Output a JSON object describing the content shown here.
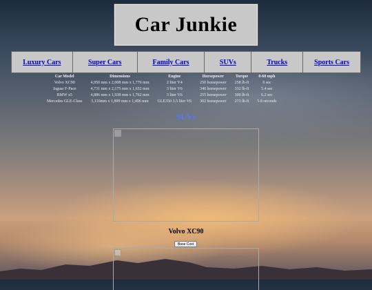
{
  "site_title": "Car Junkie",
  "nav": [
    {
      "label": "Luxury Cars"
    },
    {
      "label": "Super Cars"
    },
    {
      "label": "Family Cars"
    },
    {
      "label": "SUVs"
    },
    {
      "label": "Trucks"
    },
    {
      "label": "Sports Cars"
    }
  ],
  "specs_table": {
    "headers": [
      "Car Model",
      "Dimensions",
      "Engine",
      "Horsepower",
      "Torque",
      "0-60 mph"
    ],
    "rows": [
      [
        "Volvo XC90",
        "4,950 mm x 2,008 mm x 1,776 mm",
        "2 liter V4",
        "250 horsepower",
        "258 lb-ft",
        "6 sec"
      ],
      [
        "Jaguar F-Pace",
        "4,731 mm x 2,175 mm x 1,652 mm",
        "3 liter V6",
        "340 horsepower",
        "332 lb-ft",
        "5.4 sec"
      ],
      [
        "BMW x5",
        "4,886 mm x 1,938 mm x 1,762 mm",
        "3 liter V6",
        "255 horsepower",
        "300 lb-ft",
        "6.2 sec"
      ],
      [
        "Mercedes GLE-Class",
        "5,116mm x 1,899 mm x 1,496 mm",
        "GLE350 3.5 liter V6",
        "302 horsepower",
        "273 lb-ft",
        "5.8 seconds"
      ]
    ]
  },
  "section_title": "SUVs",
  "featured_car": {
    "name": "Volvo XC90",
    "button_label": "Base Cost"
  }
}
